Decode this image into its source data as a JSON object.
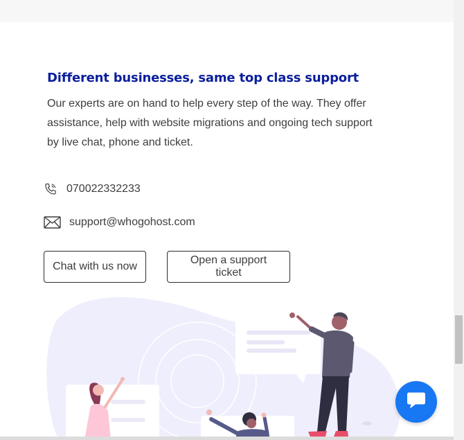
{
  "section": {
    "heading": "Different businesses, same top class support",
    "body": "Our experts are on hand to help every step of the way. They offer assistance, help with website migrations and ongoing tech support by live chat, phone and ticket."
  },
  "contact": {
    "phone": "070022332233",
    "phone_icon": "phone-icon",
    "email": "support@whogohost.com",
    "email_icon": "envelope-icon"
  },
  "buttons": {
    "chat_label": "Chat with us now",
    "ticket_label": "Open a support ticket"
  },
  "chat_widget": {
    "icon": "chat-bubble-icon",
    "color": "#1877f2"
  },
  "colors": {
    "heading": "#0a1f9c",
    "illustration_bg": "#efeefc",
    "accent": "#1877f2"
  }
}
